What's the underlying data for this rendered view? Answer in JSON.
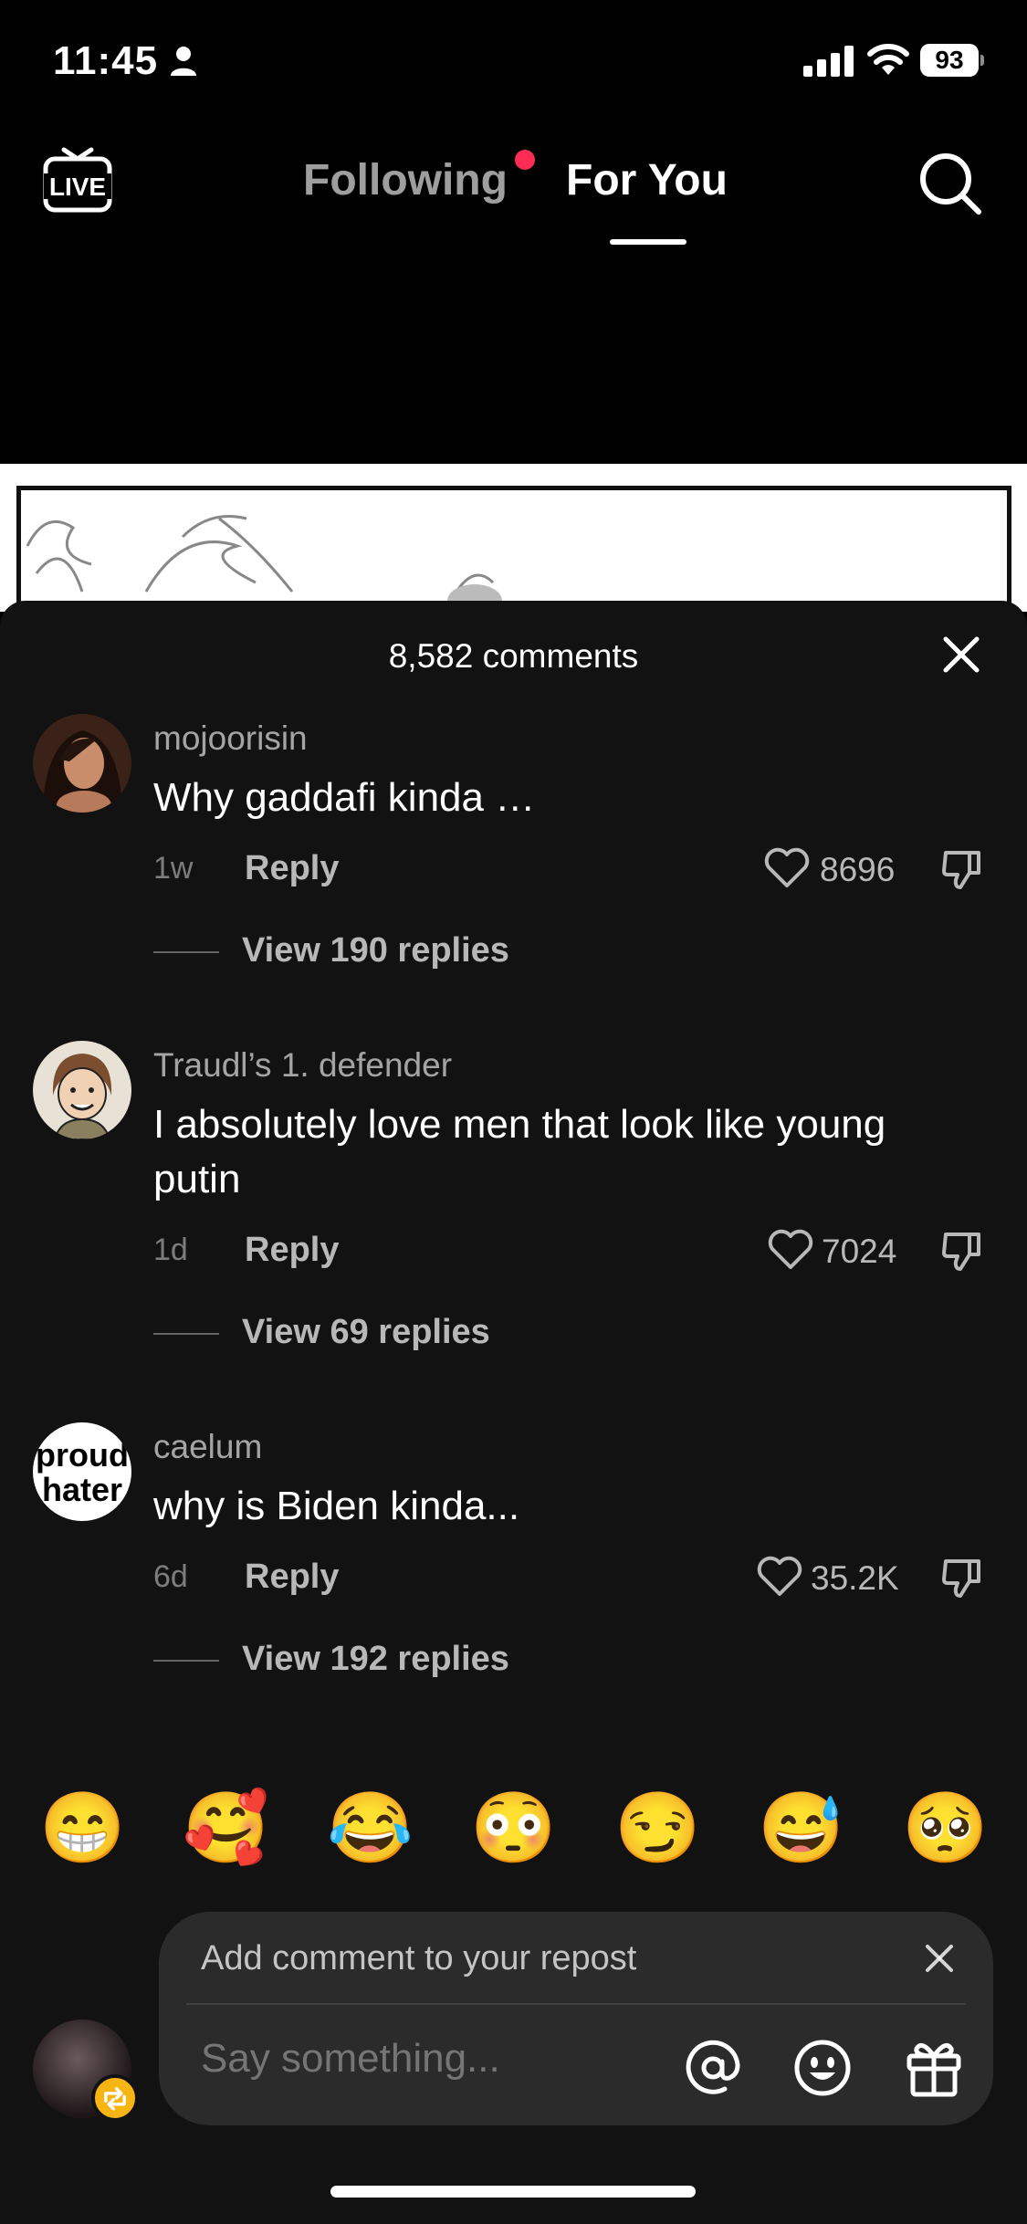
{
  "status_bar": {
    "time": "11:45",
    "battery": "93"
  },
  "nav": {
    "live_label": "LIVE",
    "tab_following": "Following",
    "tab_for_you": "For You",
    "notification_color": "#fe2c55"
  },
  "sheet": {
    "title": "8,582 comments"
  },
  "comments": [
    {
      "username": "mojoorisin",
      "text": "Why gaddafi kinda …",
      "age": "1w",
      "reply_label": "Reply",
      "likes": "8696",
      "view_replies": "View 190 replies"
    },
    {
      "username": "Traudl’s 1. defender",
      "text": "I absolutely love men that look like young putin",
      "age": "1d",
      "reply_label": "Reply",
      "likes": "7024",
      "view_replies": "View 69 replies"
    },
    {
      "username": "caelum",
      "text": "why is Biden kinda...",
      "age": "6d",
      "reply_label": "Reply",
      "likes": "35.2K",
      "view_replies": "View 192 replies",
      "avatar_text_1": "proud",
      "avatar_text_2": "hater"
    }
  ],
  "emojis": [
    "😁",
    "🥰",
    "😂",
    "😳",
    "😏",
    "😅",
    "🥺"
  ],
  "composer": {
    "repost_note": "Add comment to your repost",
    "placeholder": "Say something...",
    "badge_color": "#f7b514"
  }
}
